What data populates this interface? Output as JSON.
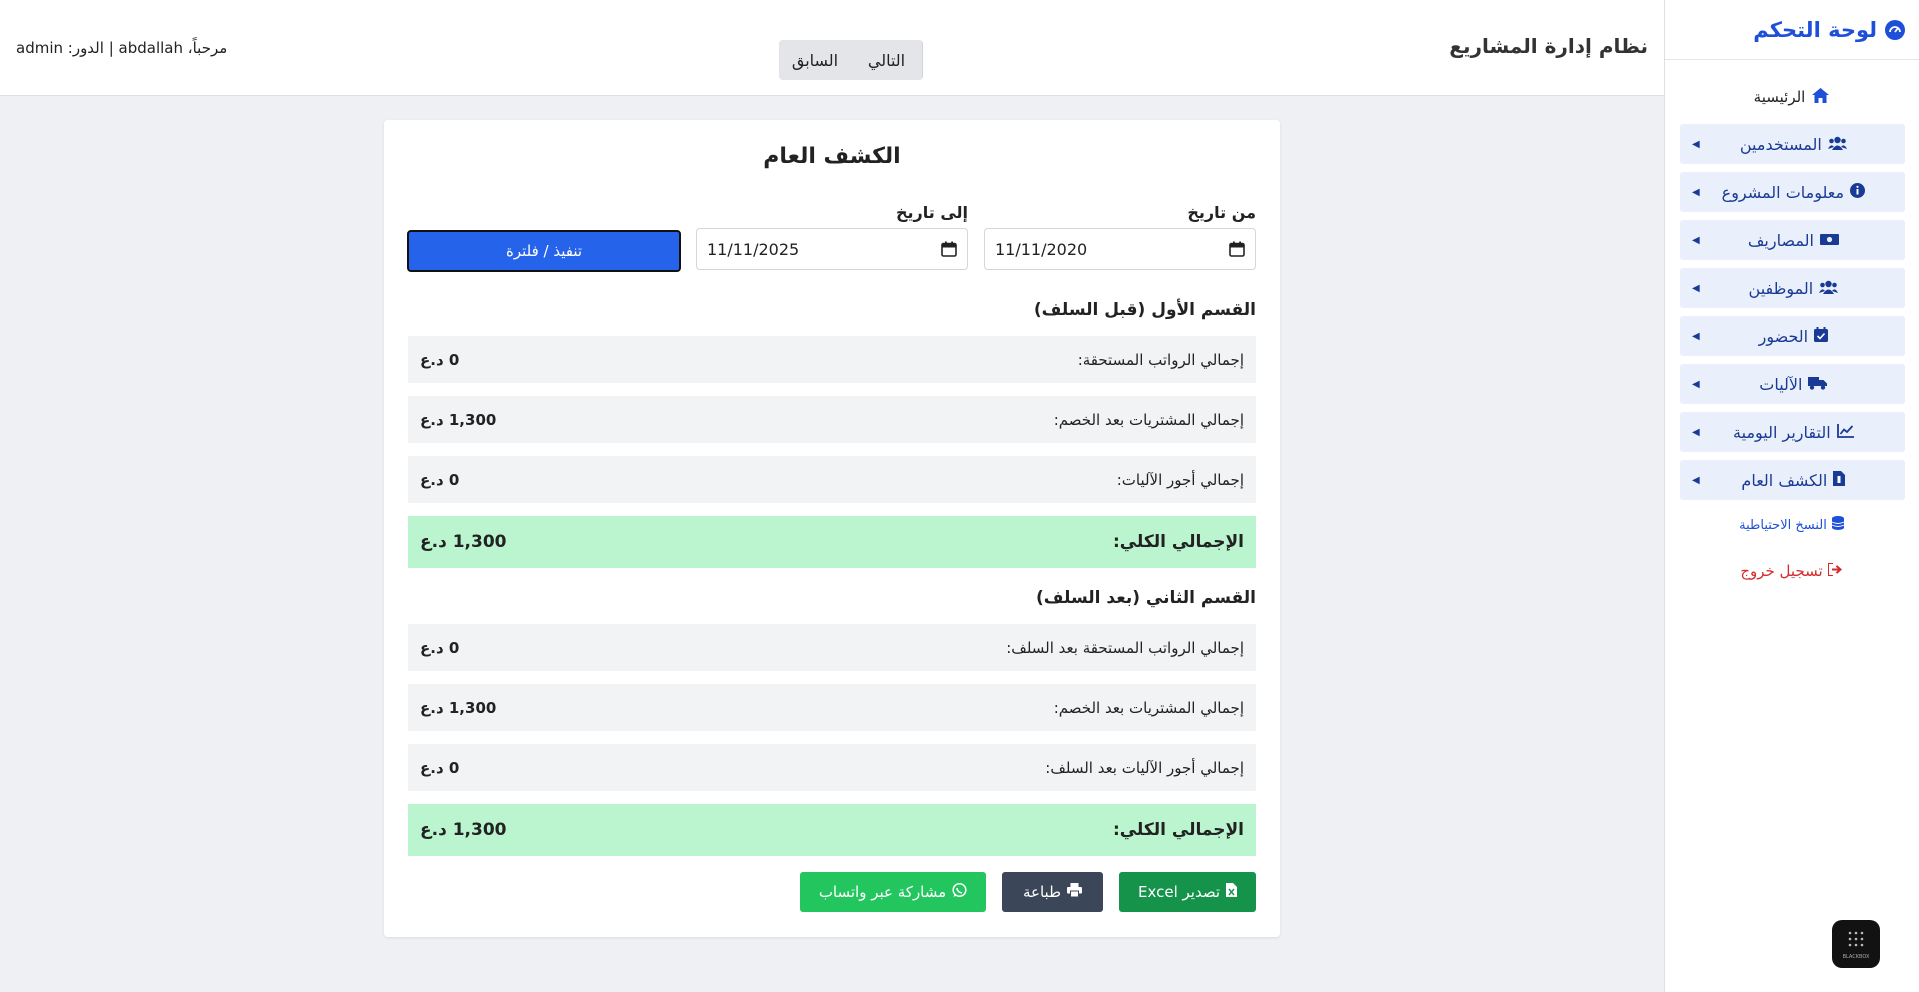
{
  "sidebar": {
    "brand": "لوحة التحكم",
    "home": "الرئيسية",
    "items": [
      {
        "label": "المستخدمين",
        "icon": "users-icon"
      },
      {
        "label": "معلومات المشروع",
        "icon": "info-icon"
      },
      {
        "label": "المصاريف",
        "icon": "money-icon"
      },
      {
        "label": "الموظفين",
        "icon": "users-icon"
      },
      {
        "label": "الحضور",
        "icon": "calendar-check-icon"
      },
      {
        "label": "الآليات",
        "icon": "truck-icon"
      },
      {
        "label": "التقارير اليومية",
        "icon": "chart-line-icon"
      },
      {
        "label": "الكشف العام",
        "icon": "file-invoice-icon"
      }
    ],
    "backup": "النسخ الاحتياطية",
    "logout": "تسجيل خروج"
  },
  "header": {
    "title": "نظام إدارة المشاريع",
    "next": "التالي",
    "prev": "السابق",
    "user_info": "مرحباً، abdallah | الدور: admin"
  },
  "report": {
    "title": "الكشف العام",
    "from_label": "من تاريخ",
    "to_label": "إلى تاريخ",
    "from_value": "11/11/2020",
    "to_value": "11/11/2025",
    "run_button": "تنفيذ / فلترة",
    "section1": {
      "title": "القسم الأول (قبل السلف)",
      "rows": [
        {
          "label": "إجمالي الرواتب المستحقة:",
          "value": "0 د.ع"
        },
        {
          "label": "إجمالي المشتريات بعد الخصم:",
          "value": "1,300 د.ع"
        },
        {
          "label": "إجمالي أجور الآليات:",
          "value": "0 د.ع"
        }
      ],
      "total_label": "الإجمالي الكلي:",
      "total_value": "1,300 د.ع"
    },
    "section2": {
      "title": "القسم الثاني (بعد السلف)",
      "rows": [
        {
          "label": "إجمالي الرواتب المستحقة بعد السلف:",
          "value": "0 د.ع"
        },
        {
          "label": "إجمالي المشتريات بعد الخصم:",
          "value": "1,300 د.ع"
        },
        {
          "label": "إجمالي أجور الآليات بعد السلف:",
          "value": "0 د.ع"
        }
      ],
      "total_label": "الإجمالي الكلي:",
      "total_value": "1,300 د.ع"
    },
    "actions": {
      "excel": "تصدير Excel",
      "print": "طباعة",
      "whatsapp": "مشاركة عبر واتساب"
    }
  },
  "badge": "BLACKBOX",
  "colors": {
    "accent": "#1e4fd8",
    "run_button": "#2563eb",
    "total_row": "#bbf5d0",
    "excel": "#15934a",
    "print": "#3b4658",
    "whatsapp": "#22c55e",
    "logout": "#d42a2a"
  }
}
